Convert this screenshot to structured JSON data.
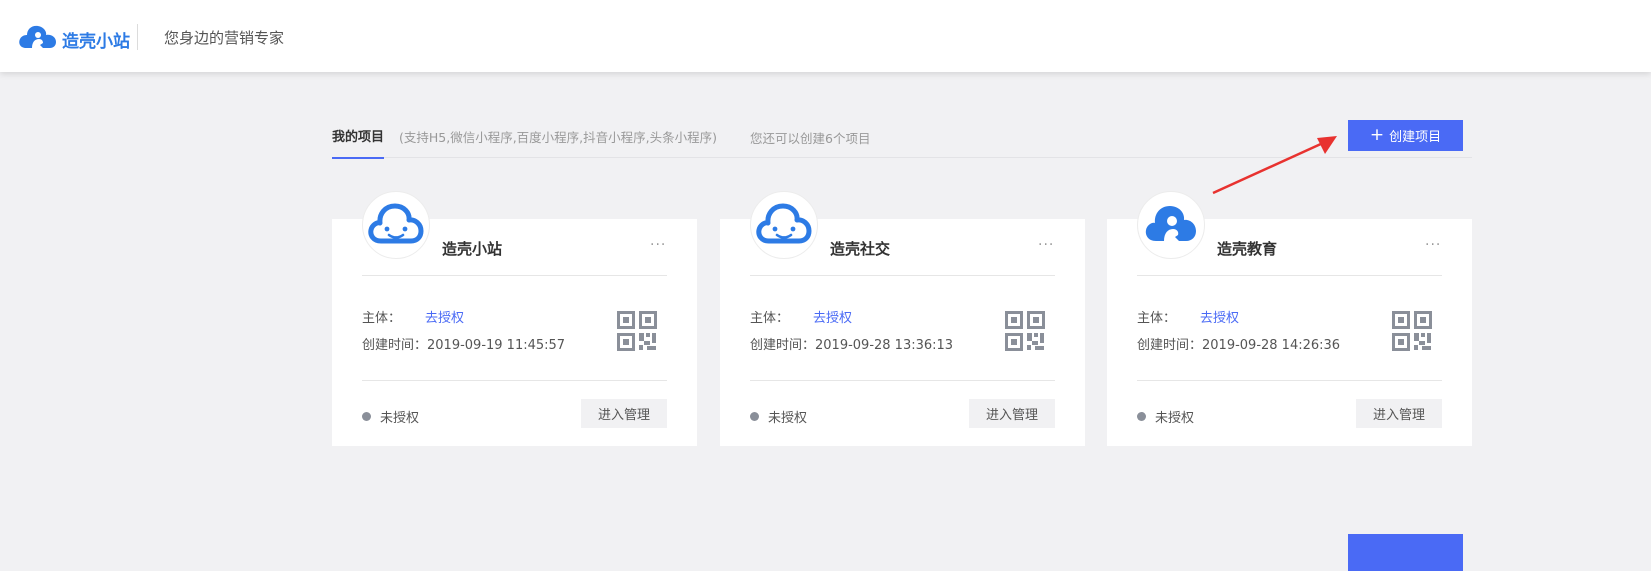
{
  "header": {
    "logo_text": "造壳小站",
    "slogan": "您身边的营销专家"
  },
  "tabs": {
    "active": "我的项目",
    "note": "(支持H5,微信小程序,百度小程序,抖音小程序,头条小程序)",
    "quota": "您还可以创建6个项目"
  },
  "create_button": {
    "label": "创建项目"
  },
  "colors": {
    "accent": "#4a6af5",
    "logo_blue": "#2d7be5",
    "arrow_red": "#e8322f"
  },
  "cards": [
    {
      "title": "造壳小站",
      "more": "···",
      "subject_label": "主体：",
      "subject_link": "去授权",
      "created": "创建时间：2019-09-19 11:45:57",
      "status": "未授权",
      "enter": "进入管理",
      "icon": "cloud-face-outline-icon"
    },
    {
      "title": "造壳社交",
      "more": "···",
      "subject_label": "主体：",
      "subject_link": "去授权",
      "created": "创建时间：2019-09-28 13:36:13",
      "status": "未授权",
      "enter": "进入管理",
      "icon": "cloud-face-outline-icon"
    },
    {
      "title": "造壳教育",
      "more": "···",
      "subject_label": "主体：",
      "subject_link": "去授权",
      "created": "创建时间：2019-09-28 14:26:36",
      "status": "未授权",
      "enter": "进入管理",
      "icon": "cloud-person-filled-icon"
    }
  ]
}
